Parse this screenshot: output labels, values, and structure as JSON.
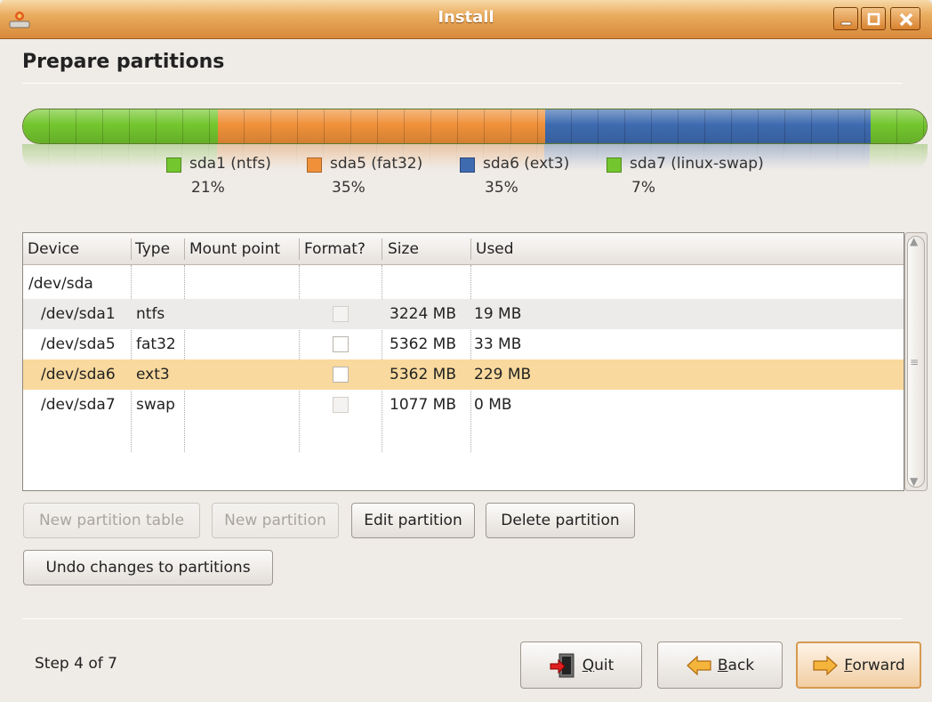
{
  "window": {
    "title": "Install"
  },
  "page": {
    "title": "Prepare partitions"
  },
  "partition_bar": {
    "segments": [
      {
        "name": "sda1 (ntfs)",
        "percent_label": "21%",
        "color": "#73c62e"
      },
      {
        "name": "sda5 (fat32)",
        "percent_label": "35%",
        "color": "#f0913a"
      },
      {
        "name": "sda6 (ext3)",
        "percent_label": "35%",
        "color": "#3e6bb0"
      },
      {
        "name": "sda7 (linux-swap)",
        "percent_label": "7%",
        "color": "#73c62e"
      }
    ]
  },
  "table": {
    "headers": [
      "Device",
      "Type",
      "Mount point",
      "Format?",
      "Size",
      "Used"
    ],
    "rows": [
      {
        "device": "/dev/sda",
        "type": "",
        "mount": "",
        "format": null,
        "size": "",
        "used": ""
      },
      {
        "device": "/dev/sda1",
        "type": "ntfs",
        "mount": "",
        "format": "disabled",
        "size": "3224 MB",
        "used": "19 MB"
      },
      {
        "device": "/dev/sda5",
        "type": "fat32",
        "mount": "",
        "format": "unchecked",
        "size": "5362 MB",
        "used": "33 MB"
      },
      {
        "device": "/dev/sda6",
        "type": "ext3",
        "mount": "",
        "format": "unchecked",
        "size": "5362 MB",
        "used": "229 MB",
        "selected": true
      },
      {
        "device": "/dev/sda7",
        "type": "swap",
        "mount": "",
        "format": "disabled",
        "size": "1077 MB",
        "used": "0 MB"
      }
    ]
  },
  "actions": {
    "new_table": "New partition table",
    "new_partition": "New partition",
    "edit_partition": "Edit partition",
    "delete_partition": "Delete partition",
    "undo": "Undo changes to partitions"
  },
  "footer": {
    "step": "Step 4 of 7",
    "quit_mnemonic": "Q",
    "quit_rest": "uit",
    "back_mnemonic": "B",
    "back_rest": "ack",
    "forward_mnemonic": "F",
    "forward_rest": "orward"
  },
  "colors": {
    "selected_row": "#f9d99d",
    "alt_row": "#ecebea",
    "title_accent": "#e9ac5e"
  }
}
